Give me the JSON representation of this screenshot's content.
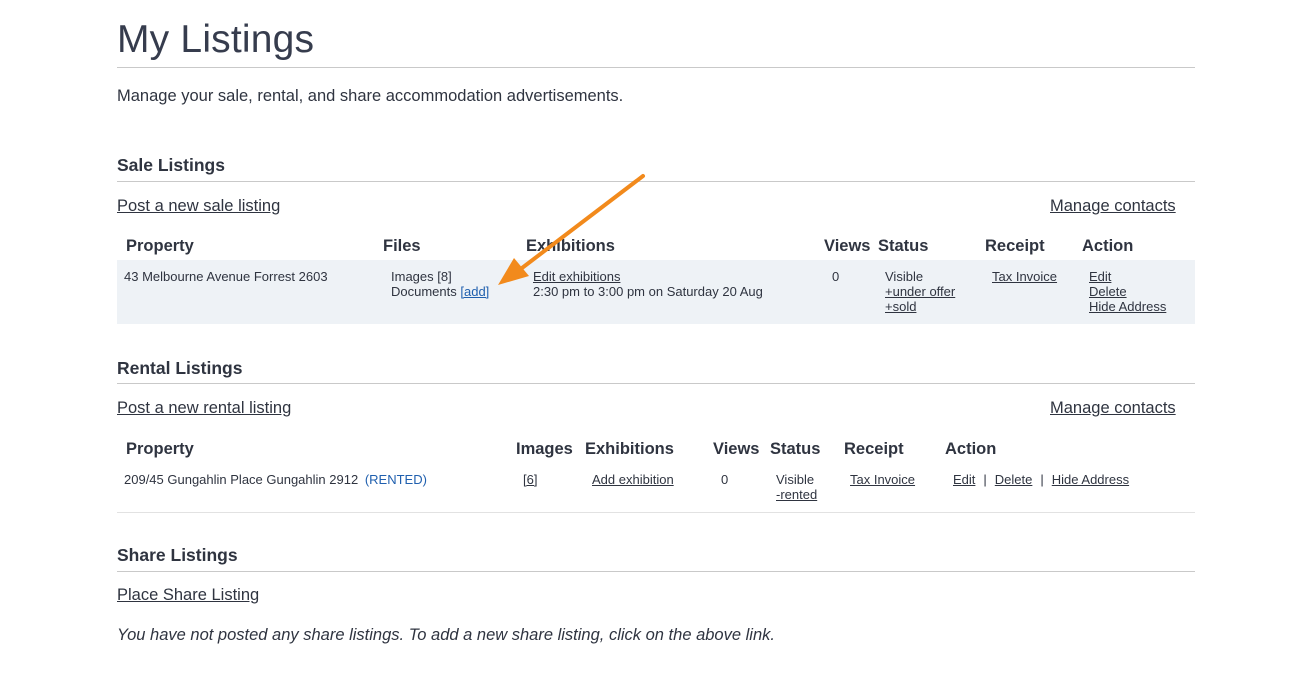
{
  "page": {
    "title": "My Listings",
    "intro": "Manage your sale, rental, and share accommodation advertisements."
  },
  "sale": {
    "title": "Sale Listings",
    "post_link": "Post a new sale listing",
    "manage_contacts": "Manage contacts",
    "headers": {
      "property": "Property",
      "files": "Files",
      "exhibitions": "Exhibitions",
      "views": "Views",
      "status": "Status",
      "receipt": "Receipt",
      "action": "Action"
    },
    "rows": [
      {
        "property": "43 Melbourne Avenue Forrest 2603",
        "images_label": "Images",
        "images_link": "[8]",
        "documents_label": "Documents",
        "documents_link": "[add]",
        "exhibition_link": "Edit exhibitions",
        "exhibition_time": "2:30 pm to 3:00 pm on Saturday 20 Aug",
        "views": "0",
        "status": "Visible",
        "status_link_1": "+under offer",
        "status_link_2": "+sold",
        "receipt": "Tax Invoice",
        "action_edit": "Edit",
        "action_delete": "Delete",
        "action_hide": "Hide Address"
      }
    ]
  },
  "rental": {
    "title": "Rental Listings",
    "post_link": "Post a new rental listing",
    "manage_contacts": "Manage contacts",
    "headers": {
      "property": "Property",
      "images": "Images",
      "exhibitions": "Exhibitions",
      "views": "Views",
      "status": "Status",
      "receipt": "Receipt",
      "action": "Action"
    },
    "rows": [
      {
        "property": "209/45 Gungahlin Place Gungahlin 2912",
        "badge": "(RENTED)",
        "images_link": "[6]",
        "exhibition_link": "Add exhibition",
        "views": "0",
        "status": "Visible",
        "status_link": "-rented",
        "receipt": "Tax Invoice",
        "action_edit": "Edit",
        "action_delete": "Delete",
        "action_hide": "Hide Address",
        "separator": "|"
      }
    ]
  },
  "share": {
    "title": "Share Listings",
    "place_link": "Place Share Listing",
    "empty_message": "You have not posted any share listings. To add a new share listing, click on the above link."
  },
  "colors": {
    "text": "#2f3440",
    "link_blue": "#1f5fae",
    "row_background": "#eef2f6",
    "annotation_arrow": "#f28a1c"
  }
}
